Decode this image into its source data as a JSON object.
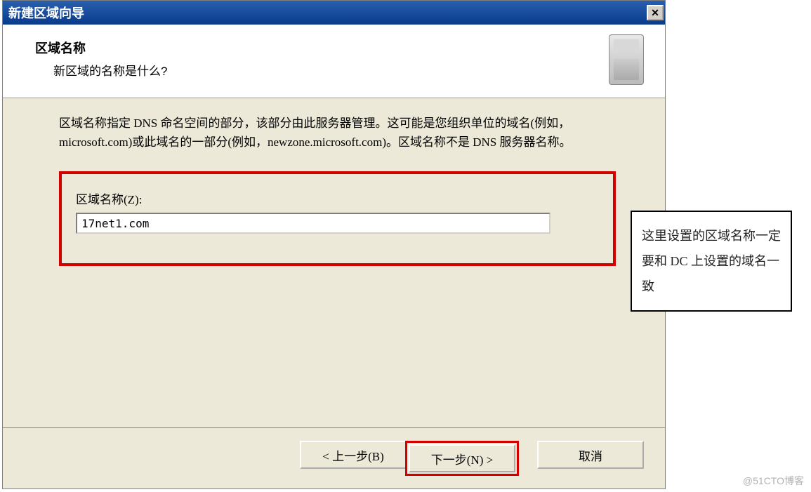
{
  "window": {
    "title": "新建区域向导",
    "close_symbol": "✕"
  },
  "header": {
    "title": "区域名称",
    "subtitle": "新区域的名称是什么?"
  },
  "body": {
    "description": "区域名称指定 DNS 命名空间的部分，该部分由此服务器管理。这可能是您组织单位的域名(例如，microsoft.com)或此域名的一部分(例如，newzone.microsoft.com)。区域名称不是 DNS 服务器名称。",
    "input_label": "区域名称(Z):",
    "input_value": "17net1.com"
  },
  "buttons": {
    "back": "< 上一步(B)",
    "next": "下一步(N) >",
    "cancel": "取消"
  },
  "annotation": {
    "text": "这里设置的区域名称一定要和 DC 上设置的域名一致"
  },
  "watermark": "@51CTO博客",
  "colors": {
    "highlight": "#d40000",
    "titlebar_start": "#2a5fad",
    "titlebar_end": "#083a8c",
    "dialog_bg": "#ece9d8"
  }
}
